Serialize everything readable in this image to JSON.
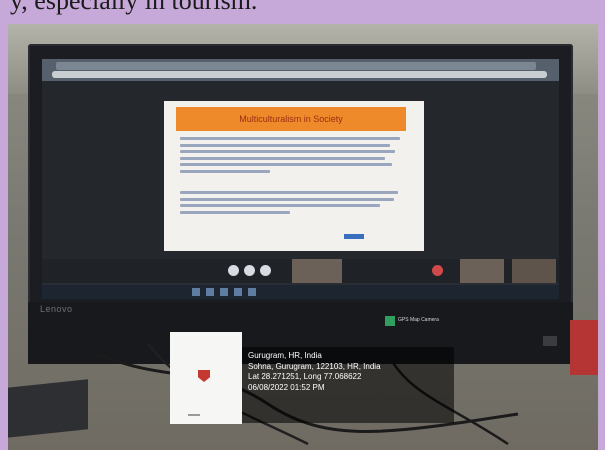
{
  "caption": "y, especially in tourism.",
  "slide": {
    "title": "Multiculturalism in Society"
  },
  "monitor_brand": "Lenovo",
  "gps_badge": "GPS Map Camera",
  "geotag": {
    "line1": "Gurugram, HR, India",
    "line2": "Sohna, Gurugram, 122103, HR, India",
    "line3": "Lat 28.271251, Long 77.068622",
    "line4": "06/08/2022 01:52 PM"
  },
  "colors": {
    "background": "#c7a9d9",
    "slide_title_bg": "#ef8a2b",
    "gps_badge": "#2f9e5e"
  }
}
